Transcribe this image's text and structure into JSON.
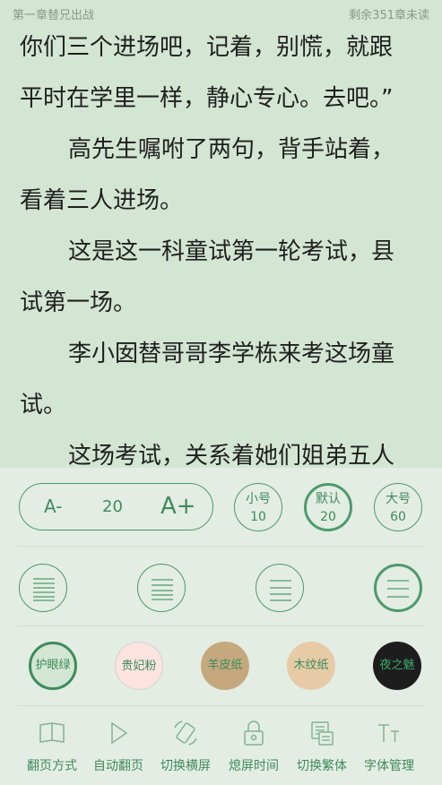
{
  "header": {
    "chapter": "第一章替兄出战",
    "remaining": "剩余351章未读"
  },
  "content": {
    "lines": [
      "你们三个进场吧，记着，别慌，就跟",
      "平时在学里一样，静心专心。去吧。”",
      "高先生嘱咐了两句，背手站着，",
      "看着三人进场。",
      "这是这一科童试第一轮考试，县",
      "试第一场。",
      "李小囡替哥哥李学栋来考这场童",
      "试。",
      "这场考试，关系着她们姐弟五人"
    ]
  },
  "font_size": {
    "minus": "A-",
    "value": "20",
    "plus": "A+"
  },
  "presets": [
    {
      "name": "小号",
      "size": "10"
    },
    {
      "name": "默认",
      "size": "20"
    },
    {
      "name": "大号",
      "size": "60"
    }
  ],
  "spacing_options": [
    "dense-lines-icon",
    "compact-lines-icon",
    "normal-lines-icon",
    "loose-lines-icon"
  ],
  "themes": [
    {
      "label": "护眼绿",
      "bg": "#d3e6d3",
      "fg": "#3d8c5c"
    },
    {
      "label": "贵妃粉",
      "bg": "#fde3e0",
      "fg": "#3d8c5c"
    },
    {
      "label": "羊皮纸",
      "bg": "#c6a87f",
      "fg": "#3d8c5c"
    },
    {
      "label": "木纹纸",
      "bg": "#e6cba6",
      "fg": "#3d8c5c"
    },
    {
      "label": "夜之魅",
      "bg": "#1d1d1d",
      "fg": "#3fa86a"
    }
  ],
  "bottom_bar": [
    {
      "label": "翻页方式",
      "icon": "book-icon"
    },
    {
      "label": "自动翻页",
      "icon": "play-icon"
    },
    {
      "label": "切换横屏",
      "icon": "rotate-screen-icon"
    },
    {
      "label": "熄屏时间",
      "icon": "lock-icon"
    },
    {
      "label": "切换繁体",
      "icon": "traditional-chinese-icon"
    },
    {
      "label": "字体管理",
      "icon": "font-icon"
    }
  ],
  "colors": {
    "accent": "#3f8a5e",
    "page_bg": "#d3e5d3",
    "panel_bg": "#e3ede3"
  }
}
